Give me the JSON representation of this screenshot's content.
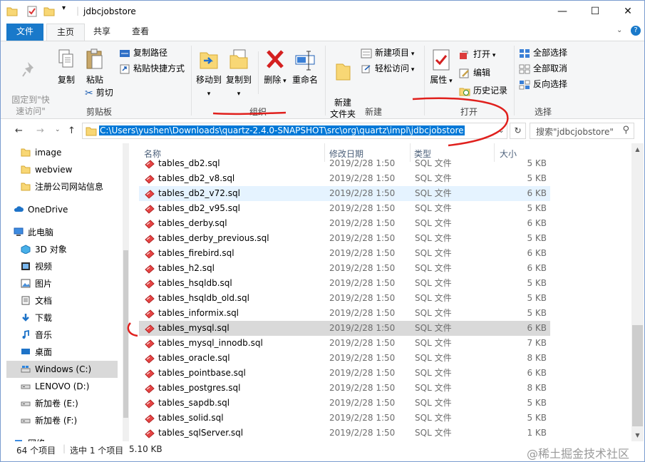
{
  "window": {
    "title": "jdbcjobstore",
    "controls": {
      "minimize": "—",
      "maximize": "☐",
      "close": "✕"
    }
  },
  "ribbon": {
    "tabs": [
      "文件",
      "主页",
      "共享",
      "查看"
    ],
    "help": "?",
    "clipboard": {
      "pin": "固定到\"快\n速访问\"",
      "copy": "复制",
      "paste": "粘贴",
      "copy_path": "复制路径",
      "paste_shortcut": "粘贴快捷方式",
      "cut": "剪切",
      "group": "剪贴板"
    },
    "organize": {
      "move_to": "移动到",
      "copy_to": "复制到",
      "delete": "删除",
      "rename": "重命名",
      "group": "组织"
    },
    "new": {
      "new_folder": "新建\n文件夹",
      "new_item": "新建项目",
      "easy_access": "轻松访问",
      "group": "新建"
    },
    "open": {
      "properties": "属性",
      "open": "打开",
      "edit": "编辑",
      "history": "历史记录",
      "group": "打开"
    },
    "select": {
      "select_all": "全部选择",
      "select_none": "全部取消",
      "invert": "反向选择",
      "group": "选择"
    }
  },
  "address": {
    "path": "C:\\Users\\yushen\\Downloads\\quartz-2.4.0-SNAPSHOT\\src\\org\\quartz\\impl\\jdbcjobstore",
    "search_placeholder": "搜索\"jdbcjobstore\""
  },
  "navpane": [
    {
      "label": "image",
      "icon": "folder-icon"
    },
    {
      "label": "webview",
      "icon": "folder-icon"
    },
    {
      "label": "注册公司网站信息",
      "icon": "folder-icon"
    },
    {
      "label": "OneDrive",
      "icon": "cloud-icon"
    },
    {
      "label": "此电脑",
      "icon": "computer-icon"
    },
    {
      "label": "3D 对象",
      "icon": "3d-objects-icon"
    },
    {
      "label": "视频",
      "icon": "video-icon"
    },
    {
      "label": "图片",
      "icon": "pictures-icon"
    },
    {
      "label": "文档",
      "icon": "documents-icon"
    },
    {
      "label": "下载",
      "icon": "download-icon"
    },
    {
      "label": "音乐",
      "icon": "music-icon"
    },
    {
      "label": "桌面",
      "icon": "desktop-icon"
    },
    {
      "label": "Windows (C:)",
      "icon": "drive-c-icon"
    },
    {
      "label": "LENOVO (D:)",
      "icon": "drive-icon"
    },
    {
      "label": "新加卷 (E:)",
      "icon": "drive-icon"
    },
    {
      "label": "新加卷 (F:)",
      "icon": "drive-icon"
    },
    {
      "label": "网络",
      "icon": "network-icon"
    }
  ],
  "columns": {
    "name": "名称",
    "date": "修改日期",
    "type": "类型",
    "size": "大小"
  },
  "files": [
    {
      "name": "tables_db2.sql",
      "date": "2019/2/28 1:50",
      "type": "SQL 文件",
      "size": "5 KB"
    },
    {
      "name": "tables_db2_v8.sql",
      "date": "2019/2/28 1:50",
      "type": "SQL 文件",
      "size": "5 KB"
    },
    {
      "name": "tables_db2_v72.sql",
      "date": "2019/2/28 1:50",
      "type": "SQL 文件",
      "size": "6 KB"
    },
    {
      "name": "tables_db2_v95.sql",
      "date": "2019/2/28 1:50",
      "type": "SQL 文件",
      "size": "5 KB"
    },
    {
      "name": "tables_derby.sql",
      "date": "2019/2/28 1:50",
      "type": "SQL 文件",
      "size": "6 KB"
    },
    {
      "name": "tables_derby_previous.sql",
      "date": "2019/2/28 1:50",
      "type": "SQL 文件",
      "size": "5 KB"
    },
    {
      "name": "tables_firebird.sql",
      "date": "2019/2/28 1:50",
      "type": "SQL 文件",
      "size": "6 KB"
    },
    {
      "name": "tables_h2.sql",
      "date": "2019/2/28 1:50",
      "type": "SQL 文件",
      "size": "6 KB"
    },
    {
      "name": "tables_hsqldb.sql",
      "date": "2019/2/28 1:50",
      "type": "SQL 文件",
      "size": "5 KB"
    },
    {
      "name": "tables_hsqldb_old.sql",
      "date": "2019/2/28 1:50",
      "type": "SQL 文件",
      "size": "5 KB"
    },
    {
      "name": "tables_informix.sql",
      "date": "2019/2/28 1:50",
      "type": "SQL 文件",
      "size": "5 KB"
    },
    {
      "name": "tables_mysql.sql",
      "date": "2019/2/28 1:50",
      "type": "SQL 文件",
      "size": "6 KB"
    },
    {
      "name": "tables_mysql_innodb.sql",
      "date": "2019/2/28 1:50",
      "type": "SQL 文件",
      "size": "7 KB"
    },
    {
      "name": "tables_oracle.sql",
      "date": "2019/2/28 1:50",
      "type": "SQL 文件",
      "size": "8 KB"
    },
    {
      "name": "tables_pointbase.sql",
      "date": "2019/2/28 1:50",
      "type": "SQL 文件",
      "size": "6 KB"
    },
    {
      "name": "tables_postgres.sql",
      "date": "2019/2/28 1:50",
      "type": "SQL 文件",
      "size": "8 KB"
    },
    {
      "name": "tables_sapdb.sql",
      "date": "2019/2/28 1:50",
      "type": "SQL 文件",
      "size": "5 KB"
    },
    {
      "name": "tables_solid.sql",
      "date": "2019/2/28 1:50",
      "type": "SQL 文件",
      "size": "5 KB"
    },
    {
      "name": "tables_sqlServer.sql",
      "date": "2019/2/28 1:50",
      "type": "SQL 文件",
      "size": "1 KB"
    }
  ],
  "hover_row": 2,
  "selected_row": 11,
  "status": {
    "count": "64 个项目",
    "selected": "选中 1 个项目",
    "size": "5.10 KB"
  },
  "watermark": "@稀土掘金技术社区",
  "colors": {
    "file_tab": "#1979ca",
    "accent": "#0078d7",
    "annotation": "#e0201d"
  }
}
